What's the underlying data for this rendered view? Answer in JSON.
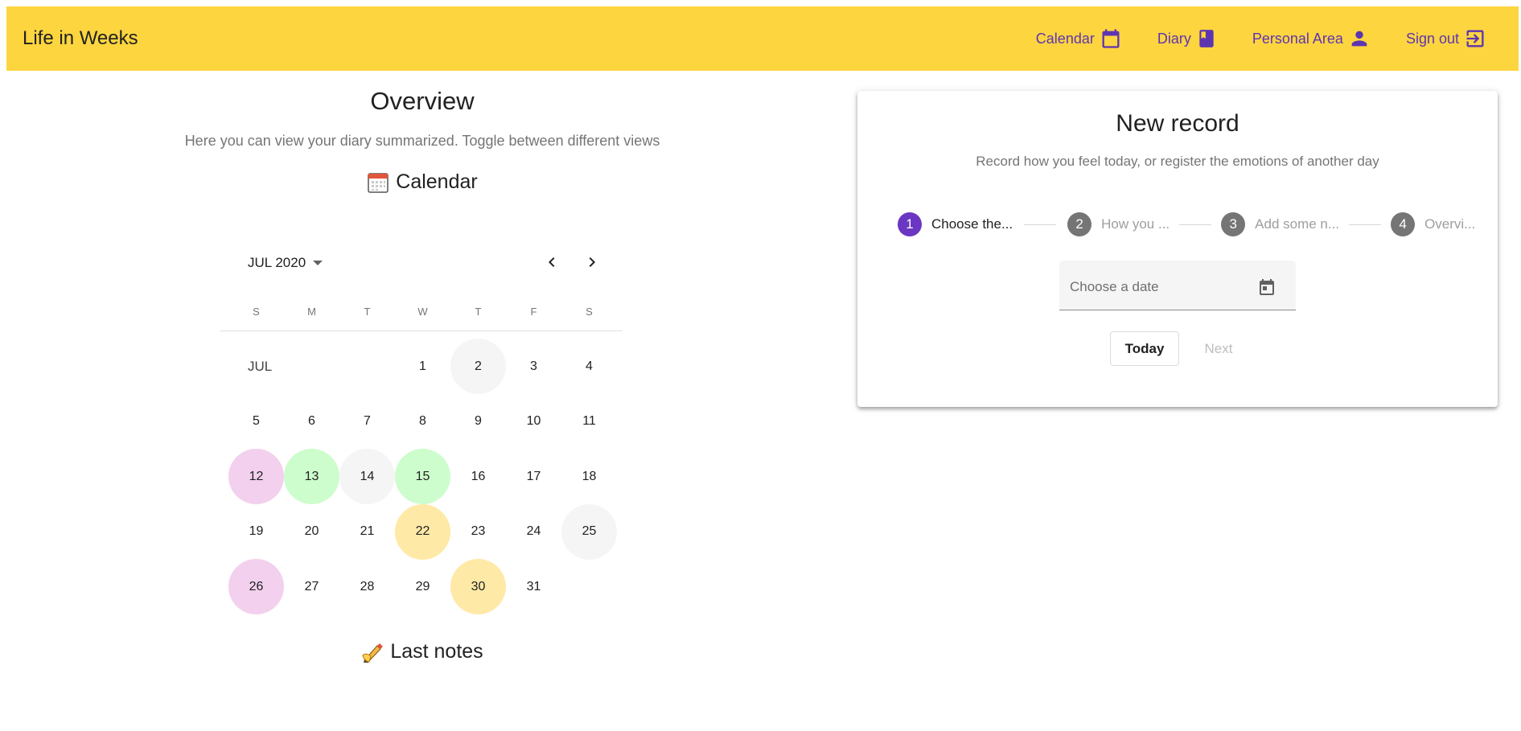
{
  "app": {
    "title": "Life in Weeks",
    "colors": {
      "bar": "#fdd53f",
      "accent": "#5e35b1"
    }
  },
  "nav": {
    "items": [
      {
        "label": "Calendar",
        "icon": "calendar-icon"
      },
      {
        "label": "Diary",
        "icon": "book-icon"
      },
      {
        "label": "Personal Area",
        "icon": "person-icon"
      },
      {
        "label": "Sign out",
        "icon": "sign-out-icon"
      }
    ]
  },
  "overview": {
    "title": "Overview",
    "subtitle": "Here you can view your diary summarized. Toggle between different views",
    "calendar_heading": "Calendar",
    "calendar_heading_icon": "calendar-emoji-icon",
    "notes_heading": "Last notes",
    "notes_heading_icon": "writing-hand-emoji-icon"
  },
  "calendar": {
    "period": "JUL 2020",
    "month_label": "JUL",
    "weekdays": [
      "S",
      "M",
      "T",
      "W",
      "T",
      "F",
      "S"
    ],
    "first_weekday_index": 3,
    "days": [
      {
        "d": "1"
      },
      {
        "d": "2",
        "mood": "grey"
      },
      {
        "d": "3"
      },
      {
        "d": "4"
      },
      {
        "d": "5"
      },
      {
        "d": "6"
      },
      {
        "d": "7"
      },
      {
        "d": "8"
      },
      {
        "d": "9"
      },
      {
        "d": "10"
      },
      {
        "d": "11"
      },
      {
        "d": "12",
        "mood": "pink"
      },
      {
        "d": "13",
        "mood": "green"
      },
      {
        "d": "14",
        "mood": "grey"
      },
      {
        "d": "15",
        "mood": "green"
      },
      {
        "d": "16"
      },
      {
        "d": "17"
      },
      {
        "d": "18"
      },
      {
        "d": "19"
      },
      {
        "d": "20"
      },
      {
        "d": "21"
      },
      {
        "d": "22",
        "mood": "yellow"
      },
      {
        "d": "23"
      },
      {
        "d": "24"
      },
      {
        "d": "25",
        "mood": "grey"
      },
      {
        "d": "26",
        "mood": "pink"
      },
      {
        "d": "27"
      },
      {
        "d": "28"
      },
      {
        "d": "29"
      },
      {
        "d": "30",
        "mood": "yellow"
      },
      {
        "d": "31"
      }
    ],
    "mood_colors": {
      "grey": "#f5f5f5",
      "pink": "#f3d0ee",
      "green": "#cdfdcd",
      "yellow": "#ffe9a6"
    }
  },
  "record": {
    "title": "New record",
    "subtitle": "Record how you feel today, or register the emotions of another day",
    "steps": [
      {
        "num": "1",
        "label": "Choose the...",
        "active": true
      },
      {
        "num": "2",
        "label": "How you ...",
        "active": false
      },
      {
        "num": "3",
        "label": "Add some n...",
        "active": false
      },
      {
        "num": "4",
        "label": "Overvi...",
        "active": false
      }
    ],
    "date_placeholder": "Choose a date",
    "today_label": "Today",
    "next_label": "Next"
  }
}
